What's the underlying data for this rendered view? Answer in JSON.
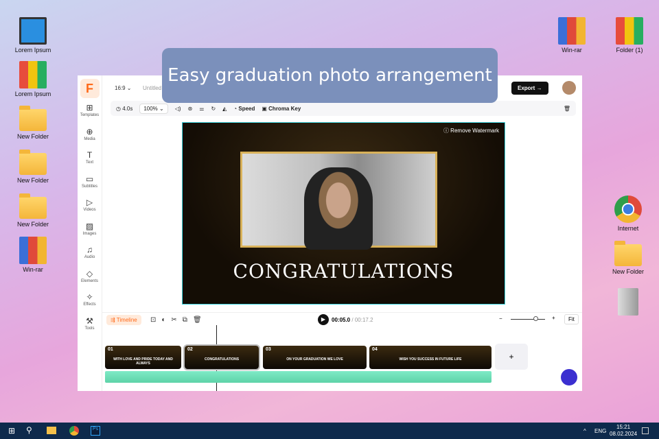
{
  "desktop": {
    "left_icons": [
      {
        "label": "Lorem Ipsum",
        "type": "pc"
      },
      {
        "label": "Lorem Ipsum",
        "type": "binders"
      },
      {
        "label": "New Folder",
        "type": "folder"
      },
      {
        "label": "New Folder",
        "type": "folder"
      },
      {
        "label": "New Folder",
        "type": "folder"
      },
      {
        "label": "Win-rar",
        "type": "winrar"
      }
    ],
    "right_icons": [
      {
        "label": "Win-rar",
        "type": "winrar"
      },
      {
        "label": "Folder (1)",
        "type": "binders"
      },
      {
        "label": "Internet",
        "type": "chrome"
      },
      {
        "label": "New Folder",
        "type": "folder"
      },
      {
        "label": "",
        "type": "trash"
      }
    ]
  },
  "banner": "Easy graduation photo arrangement",
  "app": {
    "logo": "F",
    "aspect": "16:9",
    "title": "Untitled",
    "export": "Export",
    "sidebar": [
      "Templates",
      "Media",
      "Text",
      "Subtitles",
      "Videos",
      "Images",
      "Audio",
      "Elements",
      "Effects",
      "Tools"
    ],
    "toolbar": {
      "duration": "4.0s",
      "zoom": "100%",
      "speed": "Speed",
      "chroma": "Chroma Key"
    },
    "canvas": {
      "watermark": "Remove Watermark",
      "headline": "CONGRATULATIONS"
    },
    "timeline": {
      "label": "Timeline",
      "current": "00:05.0",
      "total": "/ 00:17.2",
      "fit": "Fit",
      "clips": [
        {
          "num": "01",
          "text": "WITH LOVE AND PRIDE TODAY AND ALWAYS"
        },
        {
          "num": "02",
          "text": "CONGRATULATIONS"
        },
        {
          "num": "03",
          "text": "ON YOUR GRADUATION WE LOVE"
        },
        {
          "num": "04",
          "text": "WISH YOU SUCCESS IN FUTURE LIFE"
        }
      ],
      "add": "+"
    }
  },
  "taskbar": {
    "lang": "ENG",
    "time": "15:21",
    "date": "08.02.2024"
  }
}
